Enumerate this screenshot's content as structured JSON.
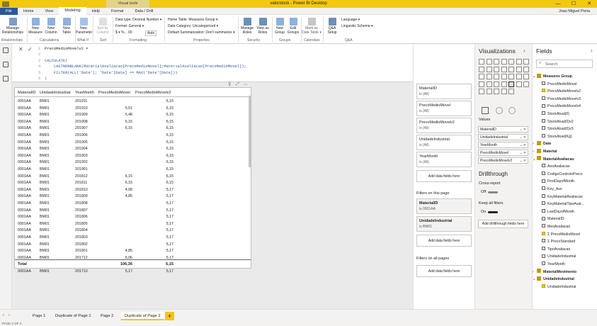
{
  "titlebar": {
    "visual_tools": "Visual tools",
    "title": "valorstock - Power BI Desktop",
    "min": "—",
    "max": "☐",
    "close": "✕"
  },
  "tabs": [
    "File",
    "Home",
    "View",
    "Modeling",
    "Help",
    "Format",
    "Data / Drill"
  ],
  "user": "Joao Miguel Pena",
  "ribbon": {
    "manage_relationships": "Manage Relationships",
    "new_measure": "New Measure",
    "new_column": "New Column",
    "new_table": "New Table",
    "new_parameter": "New Parameter",
    "sort_by_column": "Sort by Column",
    "data_type": "Data type: Decimal Number ▾",
    "format": "Format: General ▾",
    "format_symbols": "$ ▾  %  ,  .00",
    "auto": "Auto",
    "home_table": "Home Table: Measures Group ▾",
    "data_category": "Data Category: Uncategorized ▾",
    "default_summarization": "Default Summarization: Don't summarize ▾",
    "manage_roles": "Manage Roles",
    "view_as_roles": "View as Roles",
    "new_group": "New Group",
    "edit_groups": "Edit Groups",
    "mark_as_date_table": "Mark as Date Table ▾",
    "qa_setup": "Q&A Setup",
    "language": "Language ▾",
    "linguistic_schema": "Linguistic Schema ▾",
    "groups": [
      "Relationships",
      "Calculations",
      "What If",
      "Sort",
      "Formatting",
      "Properties",
      "Security",
      "Groups",
      "Calendars",
      "Q&A"
    ]
  },
  "formula": {
    "lines": [
      {
        "n": "1",
        "code": "PrecoMedioMovelv2 ="
      },
      {
        "n": "2",
        "code": ""
      },
      {
        "n": "3",
        "code": "CALCULATE("
      },
      {
        "n": "4",
        "code": "    LASTNONBLANK(MaterialAvaliacao[PrecoMedioMovel];MaterialAvaliacao[PrecoMedioMovel]);"
      },
      {
        "n": "5",
        "code": "    FILTER(ALL('Date'); 'Date'[Date] <= MAX('Date'[Date]))"
      },
      {
        "n": "6",
        "code": ")"
      }
    ]
  },
  "table": {
    "headers": [
      "MaterialID",
      "UnidadeIndustrial",
      "YearMonth",
      "PrecoMedioMovel",
      "PrecoMedioMovelv2"
    ],
    "rows": [
      [
        "0001AA",
        "BM01",
        "201911",
        "",
        "6,15"
      ],
      [
        "0001AA",
        "BM01",
        "201910",
        "5,51",
        "6,15"
      ],
      [
        "0001AA",
        "BM01",
        "201909",
        "5,48",
        "6,15"
      ],
      [
        "0001AA",
        "BM01",
        "201908",
        "6,15",
        "6,15"
      ],
      [
        "0001AA",
        "BM01",
        "201907",
        "6,15",
        "6,15"
      ],
      [
        "0001AA",
        "BM01",
        "201906",
        "",
        "6,15"
      ],
      [
        "0001AA",
        "BM01",
        "201905",
        "",
        "6,15"
      ],
      [
        "0001AA",
        "BM01",
        "201904",
        "",
        "6,15"
      ],
      [
        "0001AA",
        "BM01",
        "201903",
        "",
        "6,15"
      ],
      [
        "0001AA",
        "BM01",
        "201902",
        "",
        "6,15"
      ],
      [
        "0001AA",
        "BM01",
        "201901",
        "",
        "6,15"
      ],
      [
        "0001AA",
        "BM01",
        "201812",
        "6,15",
        "6,15"
      ],
      [
        "0001AA",
        "BM01",
        "201811",
        "6,15",
        "6,15"
      ],
      [
        "0001AA",
        "BM01",
        "201810",
        "4,08",
        "5,17"
      ],
      [
        "0001AA",
        "BM01",
        "201809",
        "4,85",
        "5,17"
      ],
      [
        "0001AA",
        "BM01",
        "201808",
        "",
        "5,17"
      ],
      [
        "0001AA",
        "BM01",
        "201807",
        "",
        "5,17"
      ],
      [
        "0001AA",
        "BM01",
        "201806",
        "",
        "5,17"
      ],
      [
        "0001AA",
        "BM01",
        "201805",
        "",
        "5,17"
      ],
      [
        "0001AA",
        "BM01",
        "201804",
        "",
        "5,17"
      ],
      [
        "0001AA",
        "BM01",
        "201803",
        "",
        "5,17"
      ],
      [
        "0001AA",
        "BM01",
        "201802",
        "",
        "5,17"
      ],
      [
        "0001AA",
        "BM01",
        "201801",
        "4,85",
        "5,17"
      ],
      [
        "0001AA",
        "BM01",
        "201712",
        "5,06",
        "5,17"
      ],
      [
        "0001AA",
        "BM01",
        "201711",
        "5,02",
        "5,17"
      ],
      [
        "0001AA",
        "BM01",
        "201710",
        "5,17",
        "5,17"
      ]
    ],
    "total_label": "Total",
    "total_pmm": "106,36",
    "total_pmmv2": "6,15"
  },
  "filters": {
    "visual": [
      {
        "name": "MaterialID",
        "value": "is (All)"
      },
      {
        "name": "PrecoMedioMovel",
        "value": "is (All)"
      },
      {
        "name": "PrecoMedioMovelv2",
        "value": "is (All)"
      },
      {
        "name": "UnidadeIndustrial",
        "value": "is (All)"
      },
      {
        "name": "YearMonth",
        "value": "is (All)"
      }
    ],
    "add_here": "Add data fields here",
    "page_title": "Filters on this page",
    "page": [
      {
        "name": "MaterialID",
        "value": "is 0001AA"
      },
      {
        "name": "UnidadeIndustrial",
        "value": "is BM01"
      }
    ],
    "all_pages_title": "Filters on all pages"
  },
  "viz": {
    "title": "Visualizations",
    "values_label": "Values",
    "wells": [
      "MaterialID",
      "UnidadeIndustrial",
      "YearMonth",
      "PrecoMedioMovel",
      "PrecoMedioMovelv2"
    ],
    "drillthrough": "Drillthrough",
    "cross_report": "Cross-report",
    "off": "Off",
    "keep_all": "Keep all filters",
    "on": "On",
    "add_drill": "Add drillthrough fields here"
  },
  "fields": {
    "title": "Fields",
    "search_placeholder": "Search",
    "items": [
      {
        "kind": "table",
        "label": "Measures Group",
        "open": true
      },
      {
        "kind": "field",
        "label": "PrecoMedioMovel",
        "checked": false
      },
      {
        "kind": "field",
        "label": "PrecoMedioMovelv2",
        "checked": true
      },
      {
        "kind": "field",
        "label": "PrecoMedioMovelv3",
        "checked": false
      },
      {
        "kind": "field",
        "label": "PrecoMedioMovelv4",
        "checked": false
      },
      {
        "kind": "field",
        "label": "StockAtual(€)",
        "checked": false
      },
      {
        "kind": "field",
        "label": "StockAtual(€)v2",
        "checked": false
      },
      {
        "kind": "field",
        "label": "StockAtual(€)v3",
        "checked": false
      },
      {
        "kind": "field",
        "label": "StockAtual(Kg)",
        "checked": false
      },
      {
        "kind": "table",
        "label": "Date",
        "open": false
      },
      {
        "kind": "table",
        "label": "Material",
        "open": false
      },
      {
        "kind": "table",
        "label": "MaterialAvaliacao",
        "open": true
      },
      {
        "kind": "field",
        "label": "AnoAvaliacao",
        "checked": false
      },
      {
        "kind": "field",
        "label": "CodigoControloPreco",
        "checked": false
      },
      {
        "kind": "field",
        "label": "FirstDayofMonth",
        "checked": false
      },
      {
        "kind": "field",
        "label": "Key_Aux",
        "checked": false
      },
      {
        "kind": "field",
        "label": "KeyMaterialAvaliacao",
        "checked": false
      },
      {
        "kind": "field",
        "label": "KeyMaterialTipoAval...",
        "checked": false
      },
      {
        "kind": "field",
        "label": "LastDayofMonth",
        "checked": false
      },
      {
        "kind": "field",
        "label": "MaterialID",
        "checked": false
      },
      {
        "kind": "field",
        "label": "MesAvaliacao",
        "checked": false
      },
      {
        "kind": "field",
        "label": "Σ  PrecoMedioMovel",
        "checked": true
      },
      {
        "kind": "field",
        "label": "Σ  PrecoStandard",
        "checked": false
      },
      {
        "kind": "field",
        "label": "TipoAvaliacao",
        "checked": false
      },
      {
        "kind": "field",
        "label": "UnidadeIndustrial",
        "checked": false
      },
      {
        "kind": "field",
        "label": "YearMonth",
        "checked": false
      },
      {
        "kind": "table",
        "label": "MaterialMovimento",
        "open": false
      },
      {
        "kind": "table",
        "label": "UnidadeIndustrial",
        "open": true
      },
      {
        "kind": "field",
        "label": "UnidadeIndustrial",
        "checked": true
      }
    ]
  },
  "pages": [
    "Page 1",
    "Duplicate of Page 1",
    "Page 2",
    "Duplicate of Page 2"
  ],
  "active_page": 3,
  "add_page": "+",
  "status": "PAGE 4 OF 4",
  "colors": {
    "accent": "#f2c811",
    "file_tab": "#2b579a"
  }
}
